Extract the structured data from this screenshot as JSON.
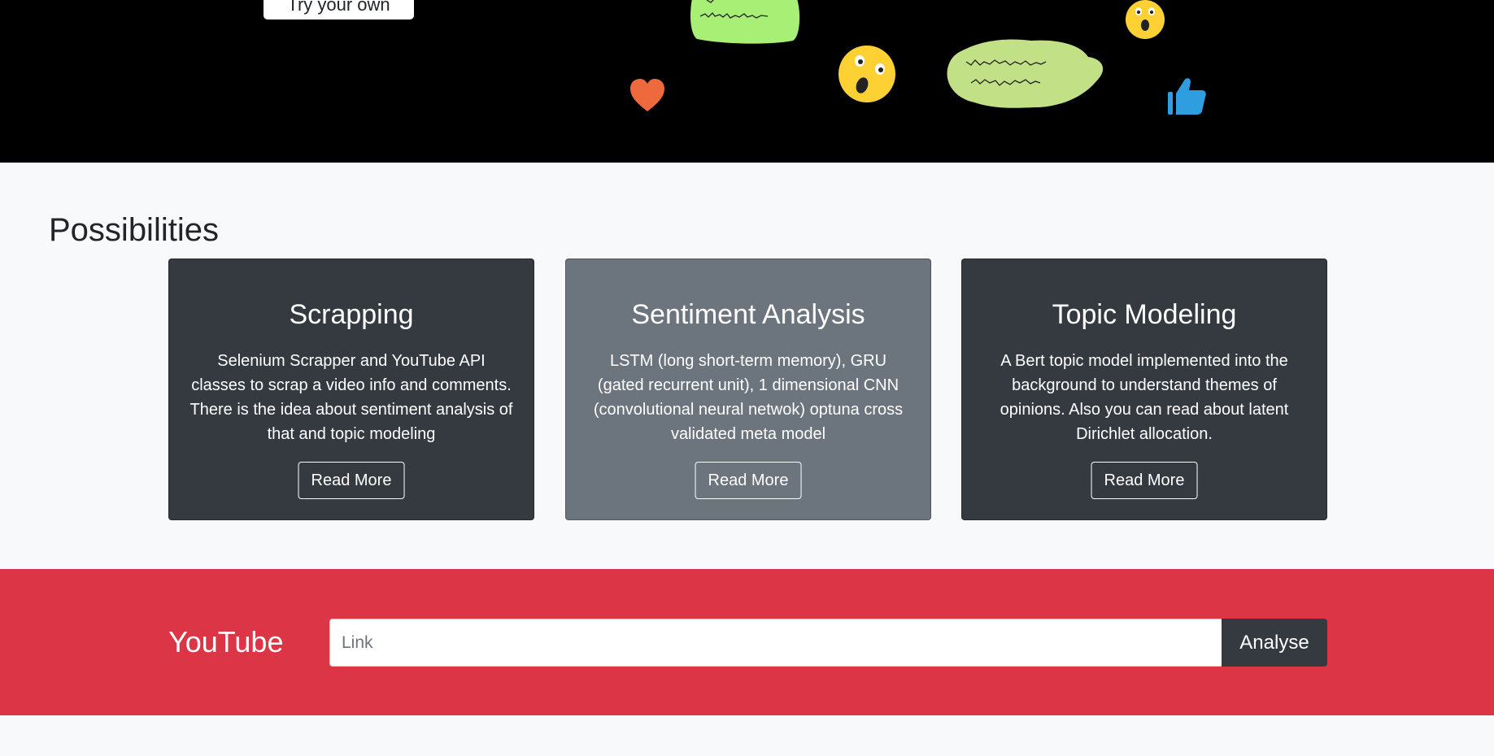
{
  "hero": {
    "try_button_label": "Try your own",
    "stickers": [
      "speech-blob-icon",
      "surprised-emoji-icon",
      "heart-icon",
      "thumbs-up-icon"
    ]
  },
  "possibilities": {
    "title": "Possibilities",
    "cards": [
      {
        "title": "Scrapping",
        "text": "Selenium Scrapper and YouTube API classes to scrap a video info and comments. There is the idea about sentiment analysis of that and topic modeling",
        "button": "Read More"
      },
      {
        "title": "Sentiment Analysis",
        "text": "LSTM (long short-term memory), GRU (gated recurrent unit), 1 dimensional CNN (convolutional neural netwok) optuna cross validated meta model",
        "button": "Read More"
      },
      {
        "title": "Topic Modeling",
        "text": "A Bert topic model implemented into the background to understand themes of opinions. Also you can read about latent Dirichlet allocation.",
        "button": "Read More"
      }
    ]
  },
  "youtube": {
    "label": "YouTube",
    "input_placeholder": "Link",
    "input_value": "",
    "analyse_label": "Analyse"
  },
  "colors": {
    "hero_bg": "#000000",
    "page_bg": "#f8f9fa",
    "card_dark": "#343a40",
    "card_grey": "#6c757d",
    "youtube_bar": "#dc3545",
    "blob_green": "#a8f075",
    "emoji_yellow": "#fdd133",
    "heart_orange": "#ee6a3c",
    "thumb_blue": "#2f9ee0"
  }
}
